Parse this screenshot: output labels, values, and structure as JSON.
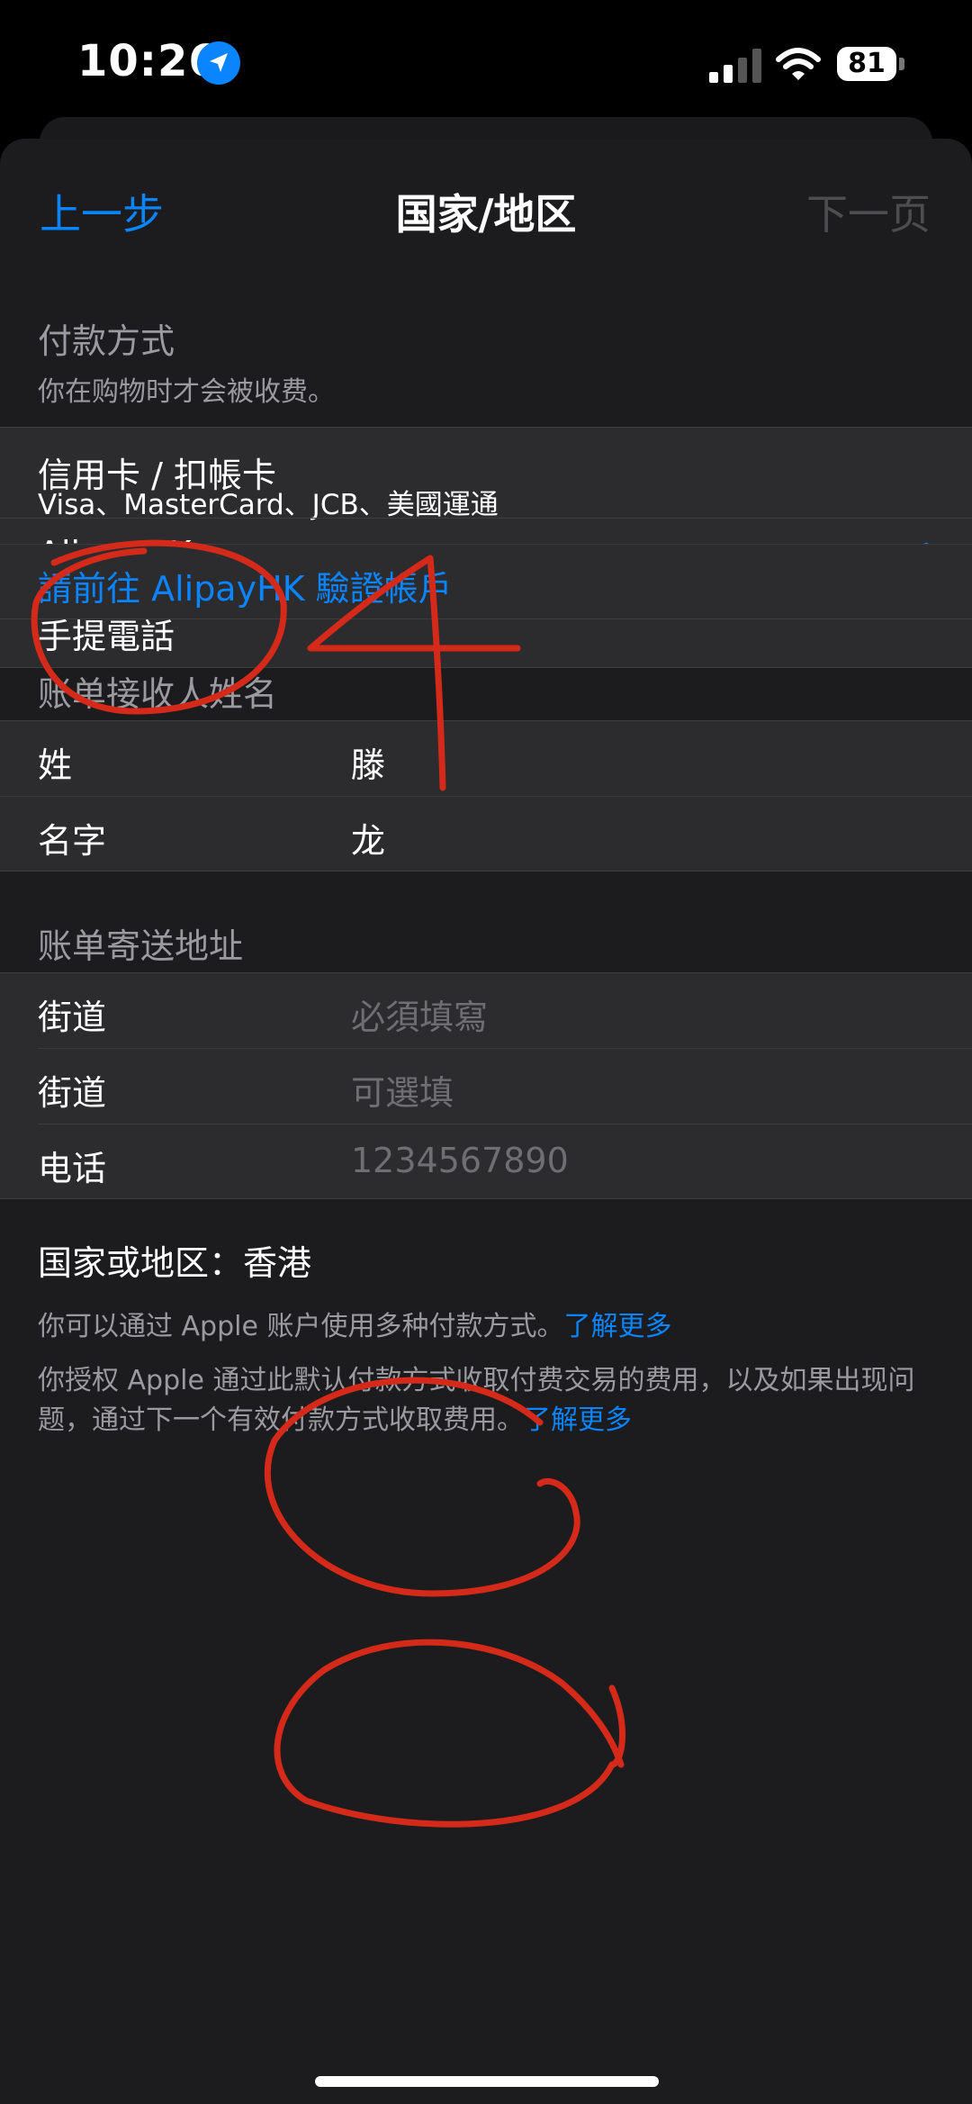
{
  "status_bar": {
    "time": "10:26",
    "battery": "81"
  },
  "nav": {
    "back": "上一步",
    "title": "国家/地区",
    "next": "下一页"
  },
  "payment": {
    "title": "付款方式",
    "subtitle": "你在购物时才会被收费。",
    "options": [
      {
        "label": "信用卡 / 扣帳卡",
        "sub": "Visa、MasterCard、JCB、美國運通",
        "selected": false
      },
      {
        "label": "AlipayHK",
        "selected": true
      },
      {
        "label": "手提電話",
        "selected": false
      }
    ],
    "verify_link": "請前往 AlipayHK 驗證帳戶"
  },
  "billing_name": {
    "title": "账单接收人姓名",
    "rows": [
      {
        "label": "姓",
        "value": "滕"
      },
      {
        "label": "名字",
        "value": "龙"
      }
    ]
  },
  "billing_address": {
    "title": "账单寄送地址",
    "rows": [
      {
        "label": "街道",
        "placeholder": "必須填寫"
      },
      {
        "label": "街道",
        "placeholder": "可選填"
      },
      {
        "label": "电话",
        "placeholder": "1234567890"
      }
    ]
  },
  "country": {
    "label": "国家或地区：",
    "value": "香港"
  },
  "footer": {
    "line1": "你可以通过 Apple 账户使用多种付款方式。",
    "line1_link": "了解更多",
    "line2": "你授权 Apple 通过此默认付款方式收取付费交易的费用，以及如果出现问题，通过下一个有效付款方式收取费用。",
    "line2_link": "了解更多"
  },
  "annotation": {
    "number": "4",
    "color": "#d52a1a"
  },
  "accent": "#0a84ff"
}
